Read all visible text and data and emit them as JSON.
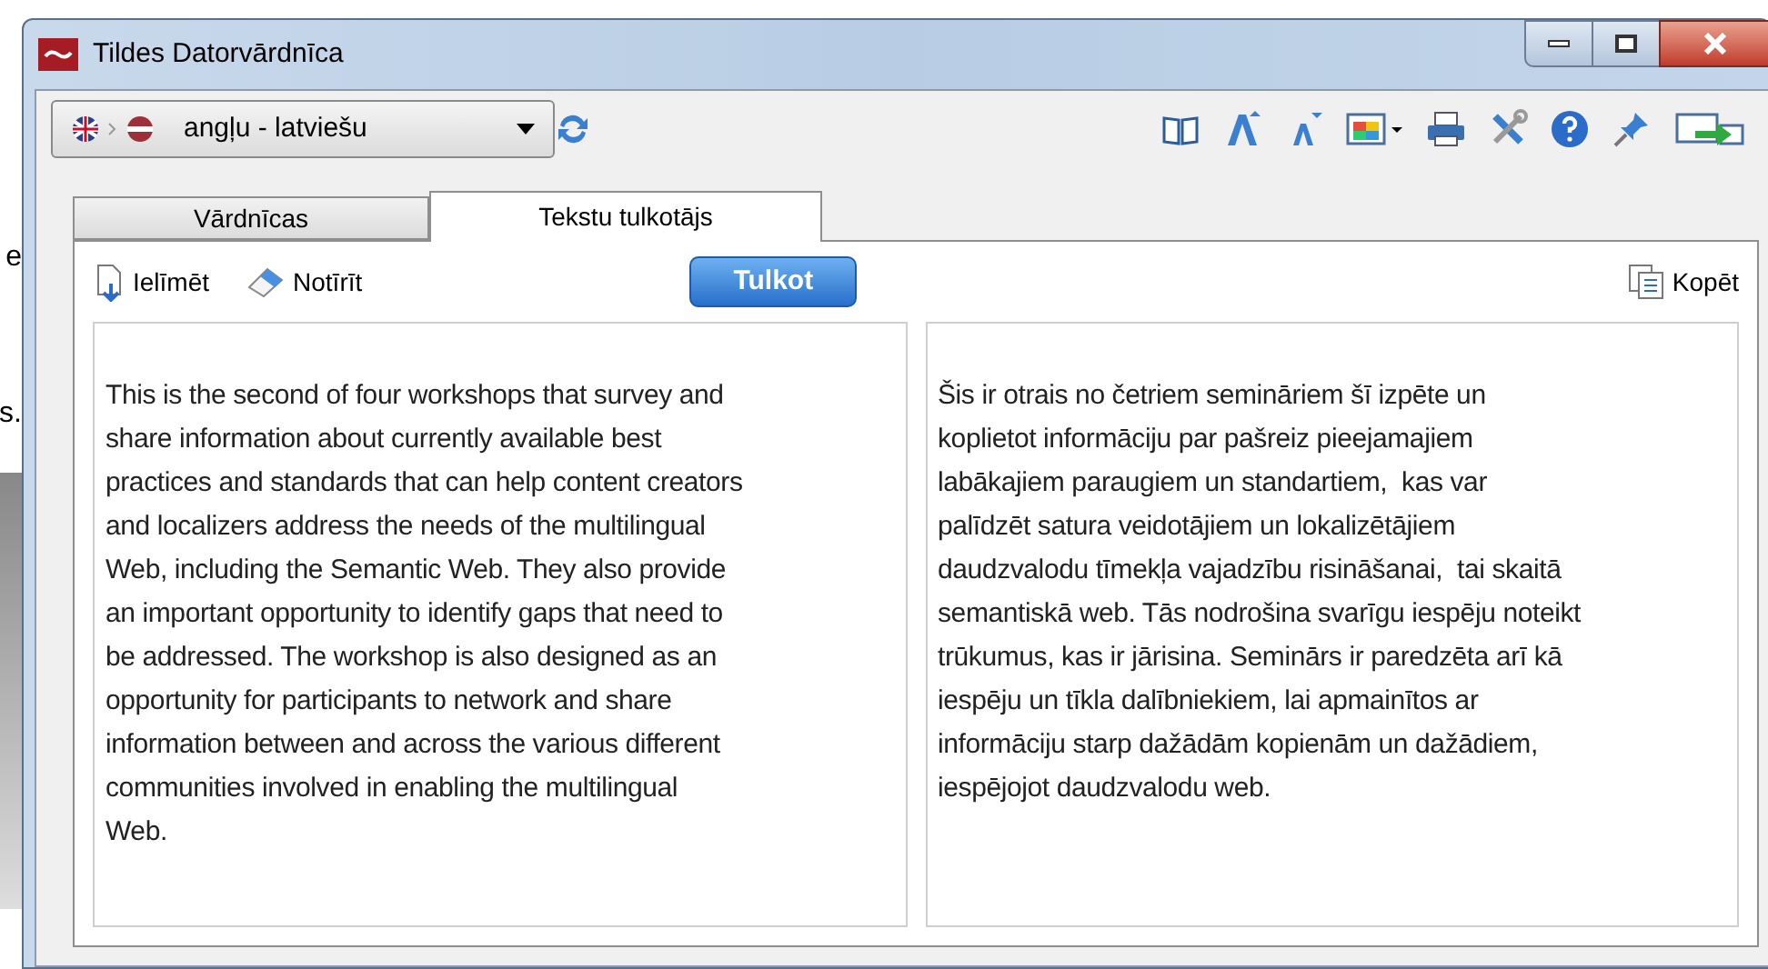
{
  "background_text": [
    "e",
    "s."
  ],
  "window": {
    "title": "Tildes Datorvārdnīca"
  },
  "language_pair": {
    "value": "angļu - latviešu"
  },
  "tabs": [
    {
      "label": "Vārdnīcas",
      "selected": false
    },
    {
      "label": "Tekstu tulkotājs",
      "selected": true
    }
  ],
  "actions": {
    "paste": "Ielīmēt",
    "clear": "Notīrīt",
    "translate": "Tulkot",
    "copy": "Kopēt"
  },
  "source_text": "This is the second of four workshops that survey and\nshare information about currently available best\npractices and standards that can help content creators\nand localizers address the needs of the multilingual\nWeb, including the Semantic Web. They also provide\nan important opportunity to identify gaps that need to\nbe addressed. The workshop is also designed as an\nopportunity for participants to network and share\ninformation between and across the various different\ncommunities involved in enabling the multilingual\nWeb.",
  "translated_text": "Šis ir otrais no četriem semināriem šī izpēte un\nkoplietot informāciju par pašreiz pieejamajiem\nlabākajiem paraugiem un standartiem,  kas var\npalīdzēt satura veidotājiem un lokalizētājiem\ndaudzvalodu tīmekļa vajadzību risināšanai,  tai skaitā\nsemantiskā web. Tās nodrošina svarīgu iespēju noteikt\ntrūkumus, kas ir jārisina. Seminārs ir paredzēta arī kā\niespēju un tīkla dalībniekiem, lai apmainītos ar\ninformāciju starp dažādām kopienām un dažādiem,\niespējojot daudzvalodu web."
}
